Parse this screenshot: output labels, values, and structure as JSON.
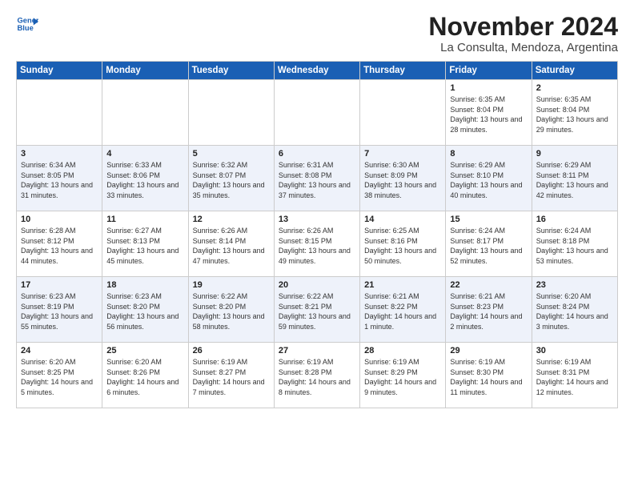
{
  "header": {
    "logo_line1": "General",
    "logo_line2": "Blue",
    "month_title": "November 2024",
    "location": "La Consulta, Mendoza, Argentina"
  },
  "days_of_week": [
    "Sunday",
    "Monday",
    "Tuesday",
    "Wednesday",
    "Thursday",
    "Friday",
    "Saturday"
  ],
  "weeks": [
    [
      {
        "day": "",
        "info": ""
      },
      {
        "day": "",
        "info": ""
      },
      {
        "day": "",
        "info": ""
      },
      {
        "day": "",
        "info": ""
      },
      {
        "day": "",
        "info": ""
      },
      {
        "day": "1",
        "info": "Sunrise: 6:35 AM\nSunset: 8:04 PM\nDaylight: 13 hours\nand 28 minutes."
      },
      {
        "day": "2",
        "info": "Sunrise: 6:35 AM\nSunset: 8:04 PM\nDaylight: 13 hours\nand 29 minutes."
      }
    ],
    [
      {
        "day": "3",
        "info": "Sunrise: 6:34 AM\nSunset: 8:05 PM\nDaylight: 13 hours\nand 31 minutes."
      },
      {
        "day": "4",
        "info": "Sunrise: 6:33 AM\nSunset: 8:06 PM\nDaylight: 13 hours\nand 33 minutes."
      },
      {
        "day": "5",
        "info": "Sunrise: 6:32 AM\nSunset: 8:07 PM\nDaylight: 13 hours\nand 35 minutes."
      },
      {
        "day": "6",
        "info": "Sunrise: 6:31 AM\nSunset: 8:08 PM\nDaylight: 13 hours\nand 37 minutes."
      },
      {
        "day": "7",
        "info": "Sunrise: 6:30 AM\nSunset: 8:09 PM\nDaylight: 13 hours\nand 38 minutes."
      },
      {
        "day": "8",
        "info": "Sunrise: 6:29 AM\nSunset: 8:10 PM\nDaylight: 13 hours\nand 40 minutes."
      },
      {
        "day": "9",
        "info": "Sunrise: 6:29 AM\nSunset: 8:11 PM\nDaylight: 13 hours\nand 42 minutes."
      }
    ],
    [
      {
        "day": "10",
        "info": "Sunrise: 6:28 AM\nSunset: 8:12 PM\nDaylight: 13 hours\nand 44 minutes."
      },
      {
        "day": "11",
        "info": "Sunrise: 6:27 AM\nSunset: 8:13 PM\nDaylight: 13 hours\nand 45 minutes."
      },
      {
        "day": "12",
        "info": "Sunrise: 6:26 AM\nSunset: 8:14 PM\nDaylight: 13 hours\nand 47 minutes."
      },
      {
        "day": "13",
        "info": "Sunrise: 6:26 AM\nSunset: 8:15 PM\nDaylight: 13 hours\nand 49 minutes."
      },
      {
        "day": "14",
        "info": "Sunrise: 6:25 AM\nSunset: 8:16 PM\nDaylight: 13 hours\nand 50 minutes."
      },
      {
        "day": "15",
        "info": "Sunrise: 6:24 AM\nSunset: 8:17 PM\nDaylight: 13 hours\nand 52 minutes."
      },
      {
        "day": "16",
        "info": "Sunrise: 6:24 AM\nSunset: 8:18 PM\nDaylight: 13 hours\nand 53 minutes."
      }
    ],
    [
      {
        "day": "17",
        "info": "Sunrise: 6:23 AM\nSunset: 8:19 PM\nDaylight: 13 hours\nand 55 minutes."
      },
      {
        "day": "18",
        "info": "Sunrise: 6:23 AM\nSunset: 8:20 PM\nDaylight: 13 hours\nand 56 minutes."
      },
      {
        "day": "19",
        "info": "Sunrise: 6:22 AM\nSunset: 8:20 PM\nDaylight: 13 hours\nand 58 minutes."
      },
      {
        "day": "20",
        "info": "Sunrise: 6:22 AM\nSunset: 8:21 PM\nDaylight: 13 hours\nand 59 minutes."
      },
      {
        "day": "21",
        "info": "Sunrise: 6:21 AM\nSunset: 8:22 PM\nDaylight: 14 hours\nand 1 minute."
      },
      {
        "day": "22",
        "info": "Sunrise: 6:21 AM\nSunset: 8:23 PM\nDaylight: 14 hours\nand 2 minutes."
      },
      {
        "day": "23",
        "info": "Sunrise: 6:20 AM\nSunset: 8:24 PM\nDaylight: 14 hours\nand 3 minutes."
      }
    ],
    [
      {
        "day": "24",
        "info": "Sunrise: 6:20 AM\nSunset: 8:25 PM\nDaylight: 14 hours\nand 5 minutes."
      },
      {
        "day": "25",
        "info": "Sunrise: 6:20 AM\nSunset: 8:26 PM\nDaylight: 14 hours\nand 6 minutes."
      },
      {
        "day": "26",
        "info": "Sunrise: 6:19 AM\nSunset: 8:27 PM\nDaylight: 14 hours\nand 7 minutes."
      },
      {
        "day": "27",
        "info": "Sunrise: 6:19 AM\nSunset: 8:28 PM\nDaylight: 14 hours\nand 8 minutes."
      },
      {
        "day": "28",
        "info": "Sunrise: 6:19 AM\nSunset: 8:29 PM\nDaylight: 14 hours\nand 9 minutes."
      },
      {
        "day": "29",
        "info": "Sunrise: 6:19 AM\nSunset: 8:30 PM\nDaylight: 14 hours\nand 11 minutes."
      },
      {
        "day": "30",
        "info": "Sunrise: 6:19 AM\nSunset: 8:31 PM\nDaylight: 14 hours\nand 12 minutes."
      }
    ]
  ]
}
